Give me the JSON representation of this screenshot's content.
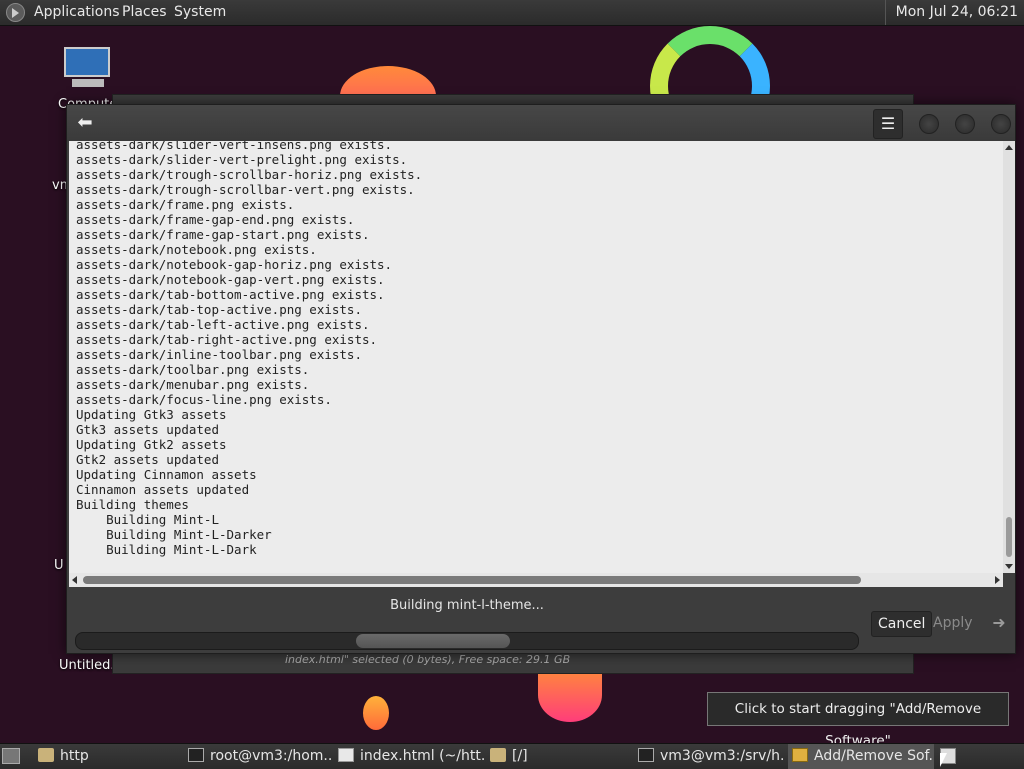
{
  "top_panel": {
    "menus": [
      "Applications",
      "Places",
      "System"
    ],
    "clock": "Mon Jul 24, 06:21"
  },
  "desktop": {
    "icons": [
      {
        "label": "Compute",
        "icon": "computer-icon"
      },
      {
        "label": "vm",
        "icon": "folder-icon"
      },
      {
        "label": "U",
        "icon": "file-icon"
      },
      {
        "label": "Untitled.",
        "icon": "file-icon"
      }
    ]
  },
  "background_window": {
    "status": "index.html\" selected (0 bytes), Free space: 29.1 GB"
  },
  "dialog": {
    "back_icon": "back-arrow-icon",
    "menu_icon": "hamburger-menu-icon",
    "log_lines": [
      "assets-dark/slider-vert-insens.png exists.",
      "assets-dark/slider-vert-prelight.png exists.",
      "assets-dark/trough-scrollbar-horiz.png exists.",
      "assets-dark/trough-scrollbar-vert.png exists.",
      "assets-dark/frame.png exists.",
      "assets-dark/frame-gap-end.png exists.",
      "assets-dark/frame-gap-start.png exists.",
      "assets-dark/notebook.png exists.",
      "assets-dark/notebook-gap-horiz.png exists.",
      "assets-dark/notebook-gap-vert.png exists.",
      "assets-dark/tab-bottom-active.png exists.",
      "assets-dark/tab-top-active.png exists.",
      "assets-dark/tab-left-active.png exists.",
      "assets-dark/tab-right-active.png exists.",
      "assets-dark/inline-toolbar.png exists.",
      "assets-dark/toolbar.png exists.",
      "assets-dark/menubar.png exists.",
      "assets-dark/focus-line.png exists.",
      "Updating Gtk3 assets",
      "Gtk3 assets updated",
      "Updating Gtk2 assets",
      "Gtk2 assets updated",
      "Updating Cinnamon assets",
      "Cinnamon assets updated",
      "Building themes",
      "    Building Mint-L",
      "    Building Mint-L-Darker",
      "    Building Mint-L-Dark"
    ],
    "status": "Building mint-l-theme...",
    "cancel_label": "Cancel",
    "apply_label": "Apply",
    "next_icon": "next-arrow-icon"
  },
  "tooltip": "Click to start dragging \"Add/Remove Software\"",
  "taskbar": {
    "tasks": [
      {
        "label": "http",
        "icon": "folder-icon",
        "active": false
      },
      {
        "label": "root@vm3:/hom...",
        "icon": "terminal-icon",
        "active": false
      },
      {
        "label": "index.html (~/htt...",
        "icon": "text-editor-icon",
        "active": false
      },
      {
        "label": "[/]",
        "icon": "folder-icon",
        "active": false
      },
      {
        "label": "vm3@vm3:/srv/h...",
        "icon": "terminal-icon",
        "active": false
      },
      {
        "label": "Add/Remove Sof...",
        "icon": "package-icon",
        "active": true
      }
    ]
  }
}
